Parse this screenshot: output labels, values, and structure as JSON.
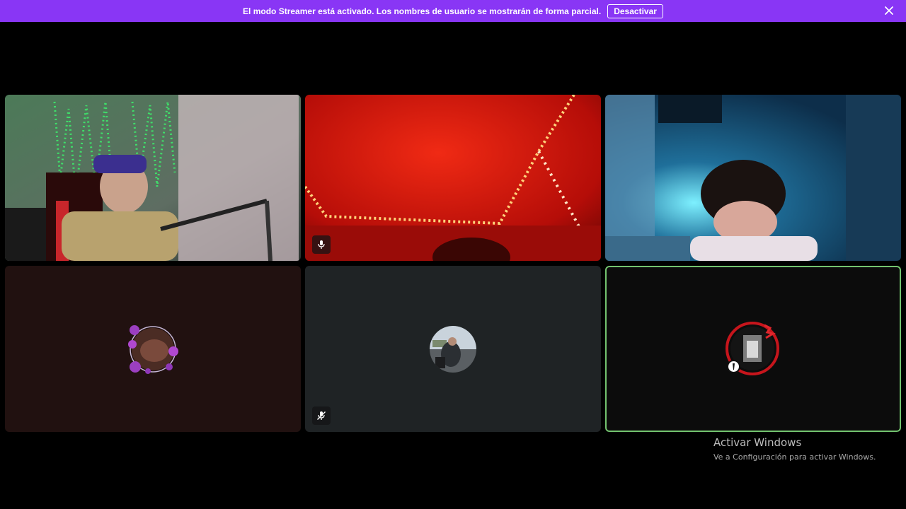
{
  "banner": {
    "message": "El modo Streamer está activado. Los nombres de usuario se mostrarán de forma parcial.",
    "button_label": "Desactivar",
    "close_icon": "close-icon",
    "background": "#8936f5"
  },
  "tiles": [
    {
      "kind": "camera",
      "scene": "green-led-room",
      "muted": false
    },
    {
      "kind": "camera",
      "scene": "red-led-ceiling",
      "muted": true,
      "mute_icon": "mic-muted-icon"
    },
    {
      "kind": "camera",
      "scene": "blue-lit-room",
      "muted": false
    },
    {
      "kind": "avatar",
      "avatar": "floral-frame-avatar",
      "background": "#211110",
      "muted": false
    },
    {
      "kind": "avatar",
      "avatar": "outdoor-photo-avatar",
      "background": "#1f2325",
      "muted": true,
      "mute_icon": "mic-off-icon"
    },
    {
      "kind": "avatar",
      "avatar": "red-ring-avatar",
      "background": "#0c0c0c",
      "speaking": true,
      "speaking_color": "#73c36f",
      "badge_icon": "status-badge-icon"
    }
  ],
  "watermark": {
    "title": "Activar Windows",
    "subtitle": "Ve a Configuración para activar Windows."
  }
}
